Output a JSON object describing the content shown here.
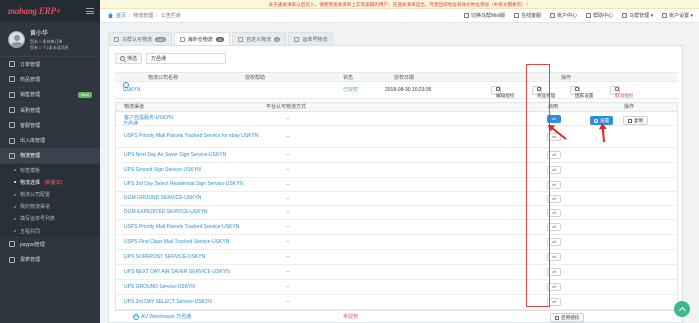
{
  "app": {
    "logo": "mabang ERP+"
  },
  "user": {
    "name": "黄小华",
    "line1": "您有",
    "line1_num": "0",
    "line1_tail": "条待审订单",
    "line2": "您有",
    "line2_num": "0",
    "line2_tail": "个1条未读消息"
  },
  "sidebar": {
    "items": [
      {
        "label": "订单管理"
      },
      {
        "label": "商品管理"
      },
      {
        "label": "销售管理",
        "badge": "New"
      },
      {
        "label": "采购管理"
      },
      {
        "label": "客服管理"
      },
      {
        "label": "出入库管理"
      },
      {
        "label": "物流管理"
      }
    ],
    "sub_items": [
      {
        "label": "标签模板"
      },
      {
        "label": "物流选择",
        "tag": "(新版本)"
      },
      {
        "label": "物流公司配置"
      },
      {
        "label": "我的物流渠道"
      },
      {
        "label": "填写运单号列表"
      },
      {
        "label": "五程共同"
      }
    ],
    "bottom_items": [
      {
        "label": "paypal管理"
      },
      {
        "label": "报表管理"
      }
    ]
  },
  "notice": "关于通关清单以后仅入，请使用速关清单上实现速输的用户：在速关清单运出，完善回邮地址和样价地址添加（中英文都要有）！",
  "breadcrumb": {
    "home": "首页",
    "level1": "物流管理",
    "level2": "公告栏目"
  },
  "toplinks": [
    "切换马帮Mini版",
    "在线客服",
    "账户中心",
    "帮助中心",
    "马帮管理 ▾",
    "账户设置 ▾"
  ],
  "tabs": [
    {
      "label": "马帮认可物流",
      "count": "133"
    },
    {
      "label": "海外仓物流",
      "count": "28"
    },
    {
      "label": "自定义物流",
      "count": "8"
    },
    {
      "label": "运单号物流",
      "count": ""
    }
  ],
  "filter": {
    "label": "筛选",
    "value": "万邑通"
  },
  "wh_header": {
    "name": "物流公司名称",
    "auth": "授权帮助",
    "state": "状态",
    "date": "授权日期",
    "op": "操作"
  },
  "wh_row": {
    "name": "USKYN Warehouse 万邑通",
    "state": "已授权",
    "date": "2018-08-30 10:23:35",
    "btn_edit": "编辑授权",
    "btn_goods": "商品管理",
    "btn_country": "国家设置",
    "btn_cancel": "取消授权"
  },
  "svc_header": {
    "channel": "物流渠道",
    "auth": "平台认可物流方式",
    "enable": "启用",
    "op": "操作"
  },
  "services": [
    {
      "name": "客户自提服务-USKYN",
      "auth": "--",
      "switch": "on",
      "ops": true
    },
    {
      "name": "USPS Priority Mail Parcels Tracked Service for ebay USKYN",
      "auth": "--",
      "switch": "off"
    },
    {
      "name": "UPS Next Day Air Saver Sign Service-USKYN",
      "auth": "--",
      "switch": "off"
    },
    {
      "name": "UPS Ground Sign Service-USKYN",
      "auth": "--",
      "switch": "off"
    },
    {
      "name": "UPS 3rd Day Select Residential Sign Service-USKYN",
      "auth": "--",
      "switch": "off"
    },
    {
      "name": "DGM GROUND SERVICE-USKYN",
      "auth": "--",
      "switch": "off"
    },
    {
      "name": "DGM EXPEDITED SERVICE-USKYN",
      "auth": "--",
      "switch": "off"
    },
    {
      "name": "USPS Priority Mail Parcels Tracked Service-USKYN",
      "auth": "--",
      "switch": "off"
    },
    {
      "name": "USPS First Class Mail Tracked Service-USKYN",
      "auth": "--",
      "switch": "off"
    },
    {
      "name": "UPS SUREPOST SERVICE-USKYN",
      "auth": "--",
      "switch": "off"
    },
    {
      "name": "UPS NEXT DAY AIR SAVER SERVICE-USKYN",
      "auth": "--",
      "switch": "off"
    },
    {
      "name": "UPS GROUND Service-USKYN",
      "auth": "--",
      "switch": "off"
    },
    {
      "name": "UPS 3rd DAY SELECT Service-USKYN",
      "auth": "--",
      "switch": "off"
    }
  ],
  "switch_labels": {
    "on": "on",
    "off": "off"
  },
  "ops": {
    "set": "设置",
    "copy": "复制"
  },
  "bottom_row": {
    "name": "AU Warehouse 万邑通",
    "state": "未授权",
    "btn": "启用授权"
  },
  "colors": {
    "accent": "#2f8fd8",
    "highlight": "#e04848",
    "sidebar": "#2f3640"
  }
}
